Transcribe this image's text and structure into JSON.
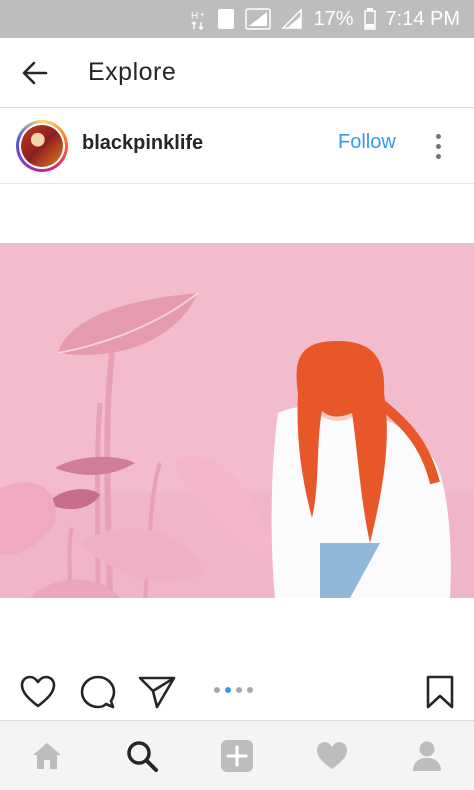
{
  "status_bar": {
    "icons": [
      "data-transfer-icon",
      "sim-1-icon",
      "signal-icon",
      "signal-icon",
      "battery-icon"
    ],
    "sim_label": "1",
    "battery": "17%",
    "time": "7:14 PM"
  },
  "header": {
    "back_icon": "arrow-left-icon",
    "title": "Explore"
  },
  "post": {
    "username": "blackpinklife",
    "follow_label": "Follow",
    "more_icon": "more-vertical-icon",
    "image_icon": "photo",
    "carousel": {
      "count": 4,
      "active_index": 1
    }
  },
  "actions": {
    "icons": [
      "heart-icon",
      "comment-icon",
      "share-icon",
      "bookmark-icon"
    ]
  },
  "bottom_nav": {
    "items": [
      "home-icon",
      "search-icon",
      "add-icon",
      "activity-icon",
      "profile-icon"
    ],
    "active": "search-icon"
  },
  "colors": {
    "accent": "#3897f0",
    "status_bar": "#bdbdbd",
    "image_bg": "#f2bccd",
    "hair": "#e8572a"
  }
}
